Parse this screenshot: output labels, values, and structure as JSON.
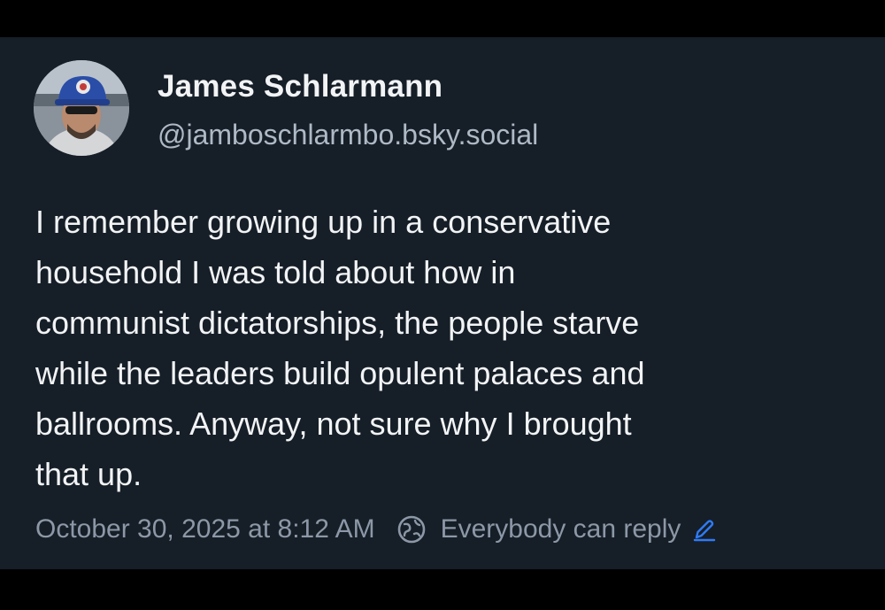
{
  "post": {
    "author": {
      "display_name": "James Schlarmann",
      "handle": "@jamboschlarmbo.bsky.social",
      "avatar_icon": "profile-photo"
    },
    "body_lines": [
      "I remember growing up in a conservative",
      "household I was told about how in",
      "communist dictatorships, the people starve",
      "while the leaders build opulent palaces and",
      "ballrooms. Anyway, not sure why I brought",
      "that up."
    ],
    "timestamp": "October 30, 2025 at 8:12 AM",
    "reply_setting": "Everybody can reply",
    "icons": {
      "audience": "globe-icon",
      "edit": "pencil-icon"
    }
  },
  "colors": {
    "page_background": "#000000",
    "card_background": "#161e27",
    "primary_text": "#f1f3f5",
    "secondary_text": "#aeb9c6",
    "muted_text": "#8c98a7",
    "accent": "#2f7bf5"
  }
}
